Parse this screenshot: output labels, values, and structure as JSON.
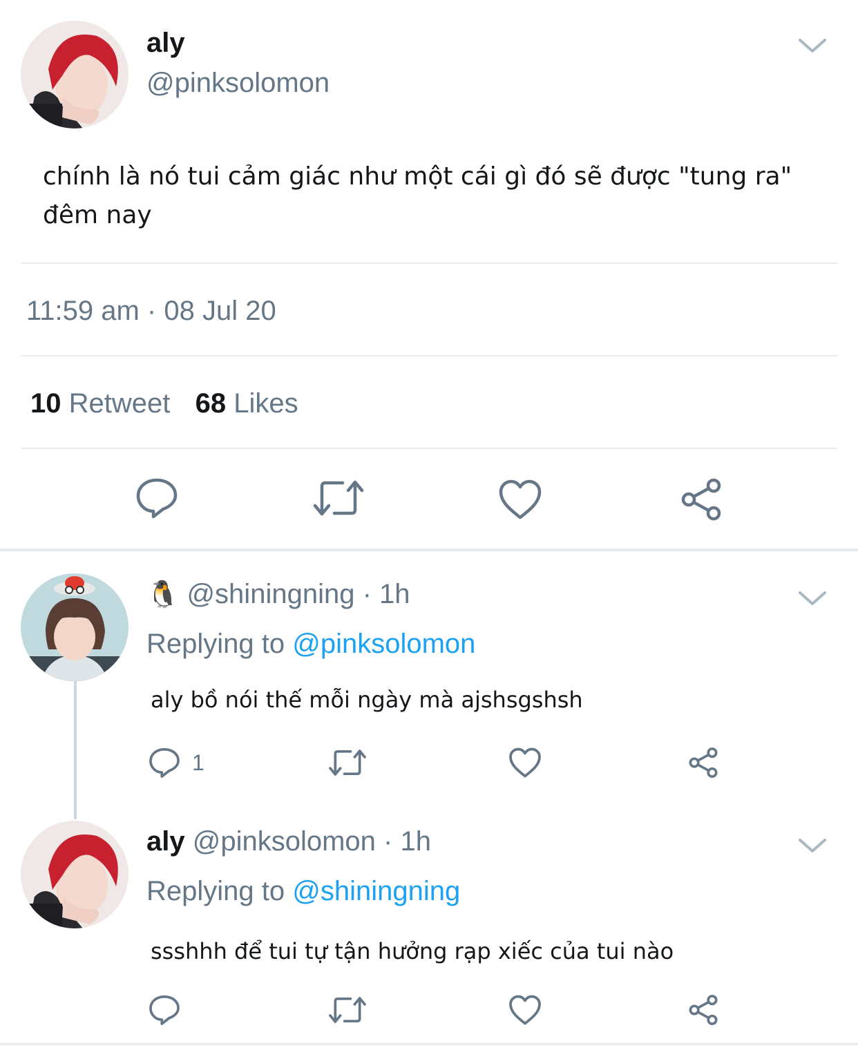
{
  "main_tweet": {
    "author_name": "aly",
    "author_handle": "@pinksolomon",
    "text_line1": "chính là nó tui cảm giác như một cái gì đó sẽ được \"tung ra\"",
    "text_line2": "đêm nay",
    "timestamp": "11:59 am · 08 Jul 20",
    "retweet_count": "10",
    "retweet_label": "Retweet",
    "like_count": "68",
    "like_label": "Likes",
    "actions": [
      "reply-icon",
      "retweet-icon",
      "like-icon",
      "share-icon"
    ]
  },
  "replies": [
    {
      "emoji": "🐧",
      "handle": "@shiningning",
      "time": "· 1h",
      "replying_label": "Replying to",
      "replying_to": "@pinksolomon",
      "text": "aly bồ nói thế mỗi ngày mà ajshsgshsh",
      "reply_count": "1"
    },
    {
      "author_name": "aly",
      "handle": "@pinksolomon",
      "time": "· 1h",
      "replying_label": "Replying to",
      "replying_to": "@shiningning",
      "text": "ssshhh để tui tự tận hưởng rạp xiếc của tui nào",
      "reply_count": ""
    }
  ],
  "colors": {
    "accent": "#1da1f2",
    "secondary_text": "#657786",
    "primary_text": "#14171a",
    "divider": "#e6ecf0"
  }
}
